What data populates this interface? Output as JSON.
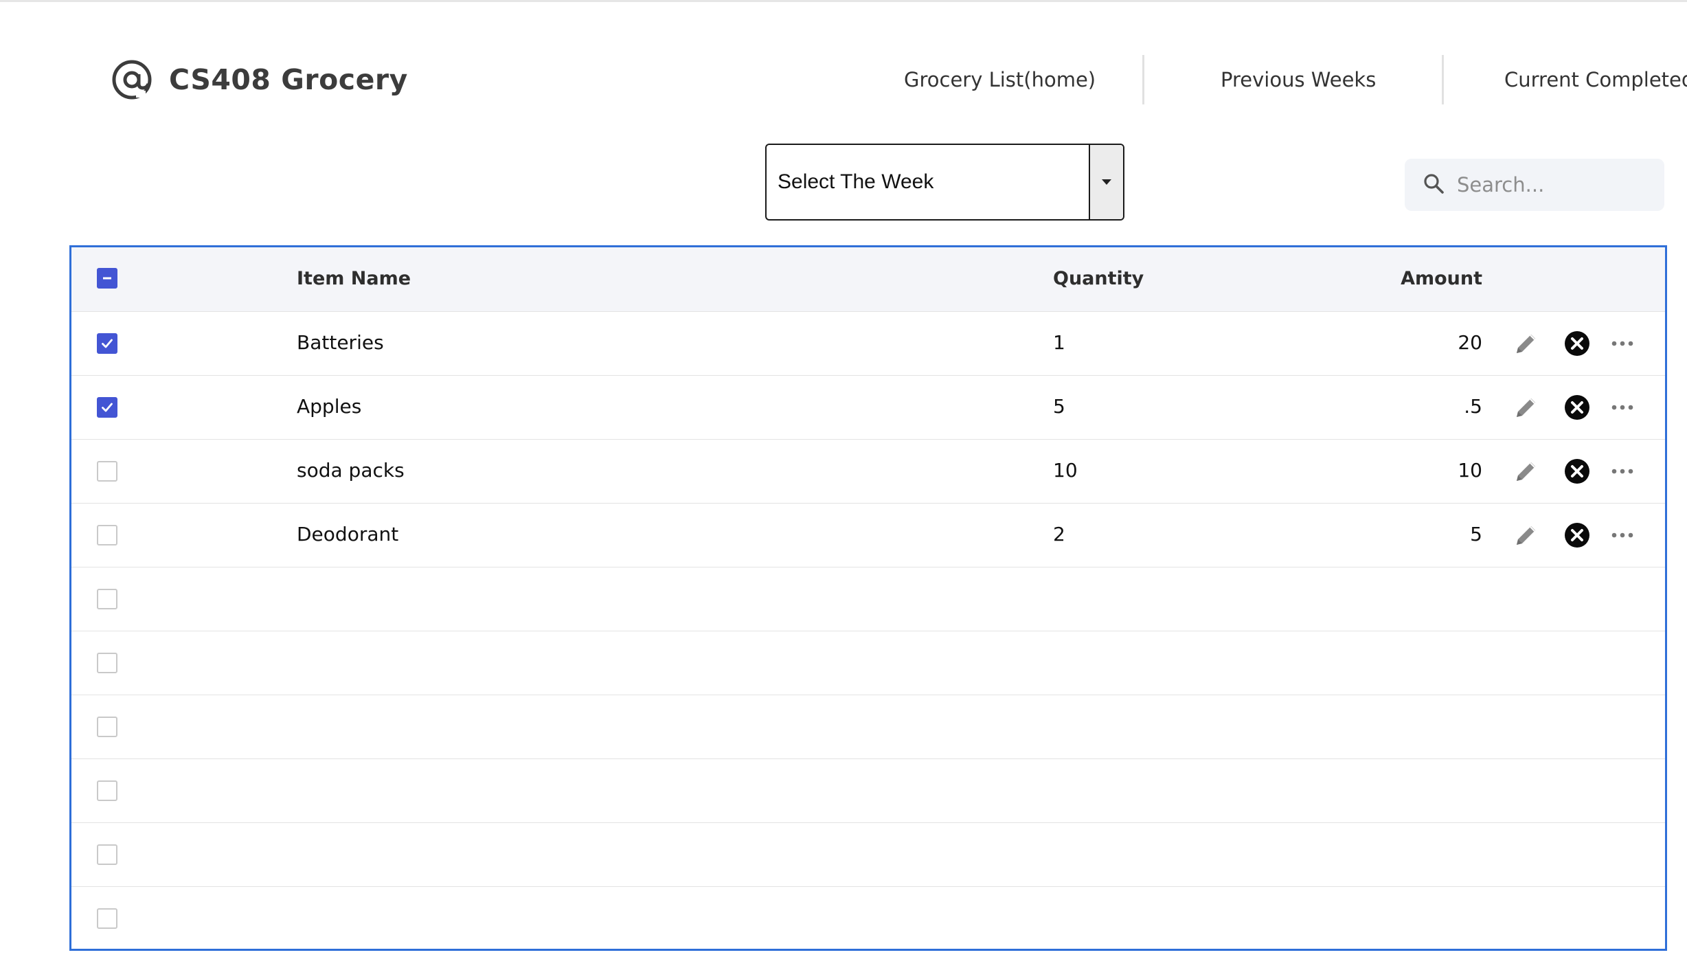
{
  "brand": {
    "title": "CS408 Grocery",
    "icon": "at-sign-icon"
  },
  "nav": {
    "items": [
      {
        "label": "Grocery List(home)"
      },
      {
        "label": "Previous Weeks"
      },
      {
        "label": "Current Completed"
      }
    ]
  },
  "week_select": {
    "selected": "Select The Week"
  },
  "search": {
    "placeholder": "Search...",
    "value": ""
  },
  "colors": {
    "accent": "#4355d4",
    "grid_border": "#2f6fd8",
    "header_bg": "#f4f5f9"
  },
  "table": {
    "columns": {
      "item_name": "Item Name",
      "quantity": "Quantity",
      "amount": "Amount"
    },
    "select_all_state": "indeterminate",
    "rows": [
      {
        "checked": true,
        "name": "Batteries",
        "quantity": "1",
        "amount": "20"
      },
      {
        "checked": true,
        "name": "Apples",
        "quantity": "5",
        "amount": ".5"
      },
      {
        "checked": false,
        "name": "soda packs",
        "quantity": "10",
        "amount": "10"
      },
      {
        "checked": false,
        "name": "Deodorant",
        "quantity": "2",
        "amount": "5"
      },
      {
        "checked": false,
        "name": "",
        "quantity": "",
        "amount": ""
      },
      {
        "checked": false,
        "name": "",
        "quantity": "",
        "amount": ""
      },
      {
        "checked": false,
        "name": "",
        "quantity": "",
        "amount": ""
      },
      {
        "checked": false,
        "name": "",
        "quantity": "",
        "amount": ""
      },
      {
        "checked": false,
        "name": "",
        "quantity": "",
        "amount": ""
      },
      {
        "checked": false,
        "name": "",
        "quantity": "",
        "amount": ""
      }
    ],
    "row_action_icons": [
      "pencil-icon",
      "close-circle-icon",
      "more-horizontal-icon"
    ]
  }
}
